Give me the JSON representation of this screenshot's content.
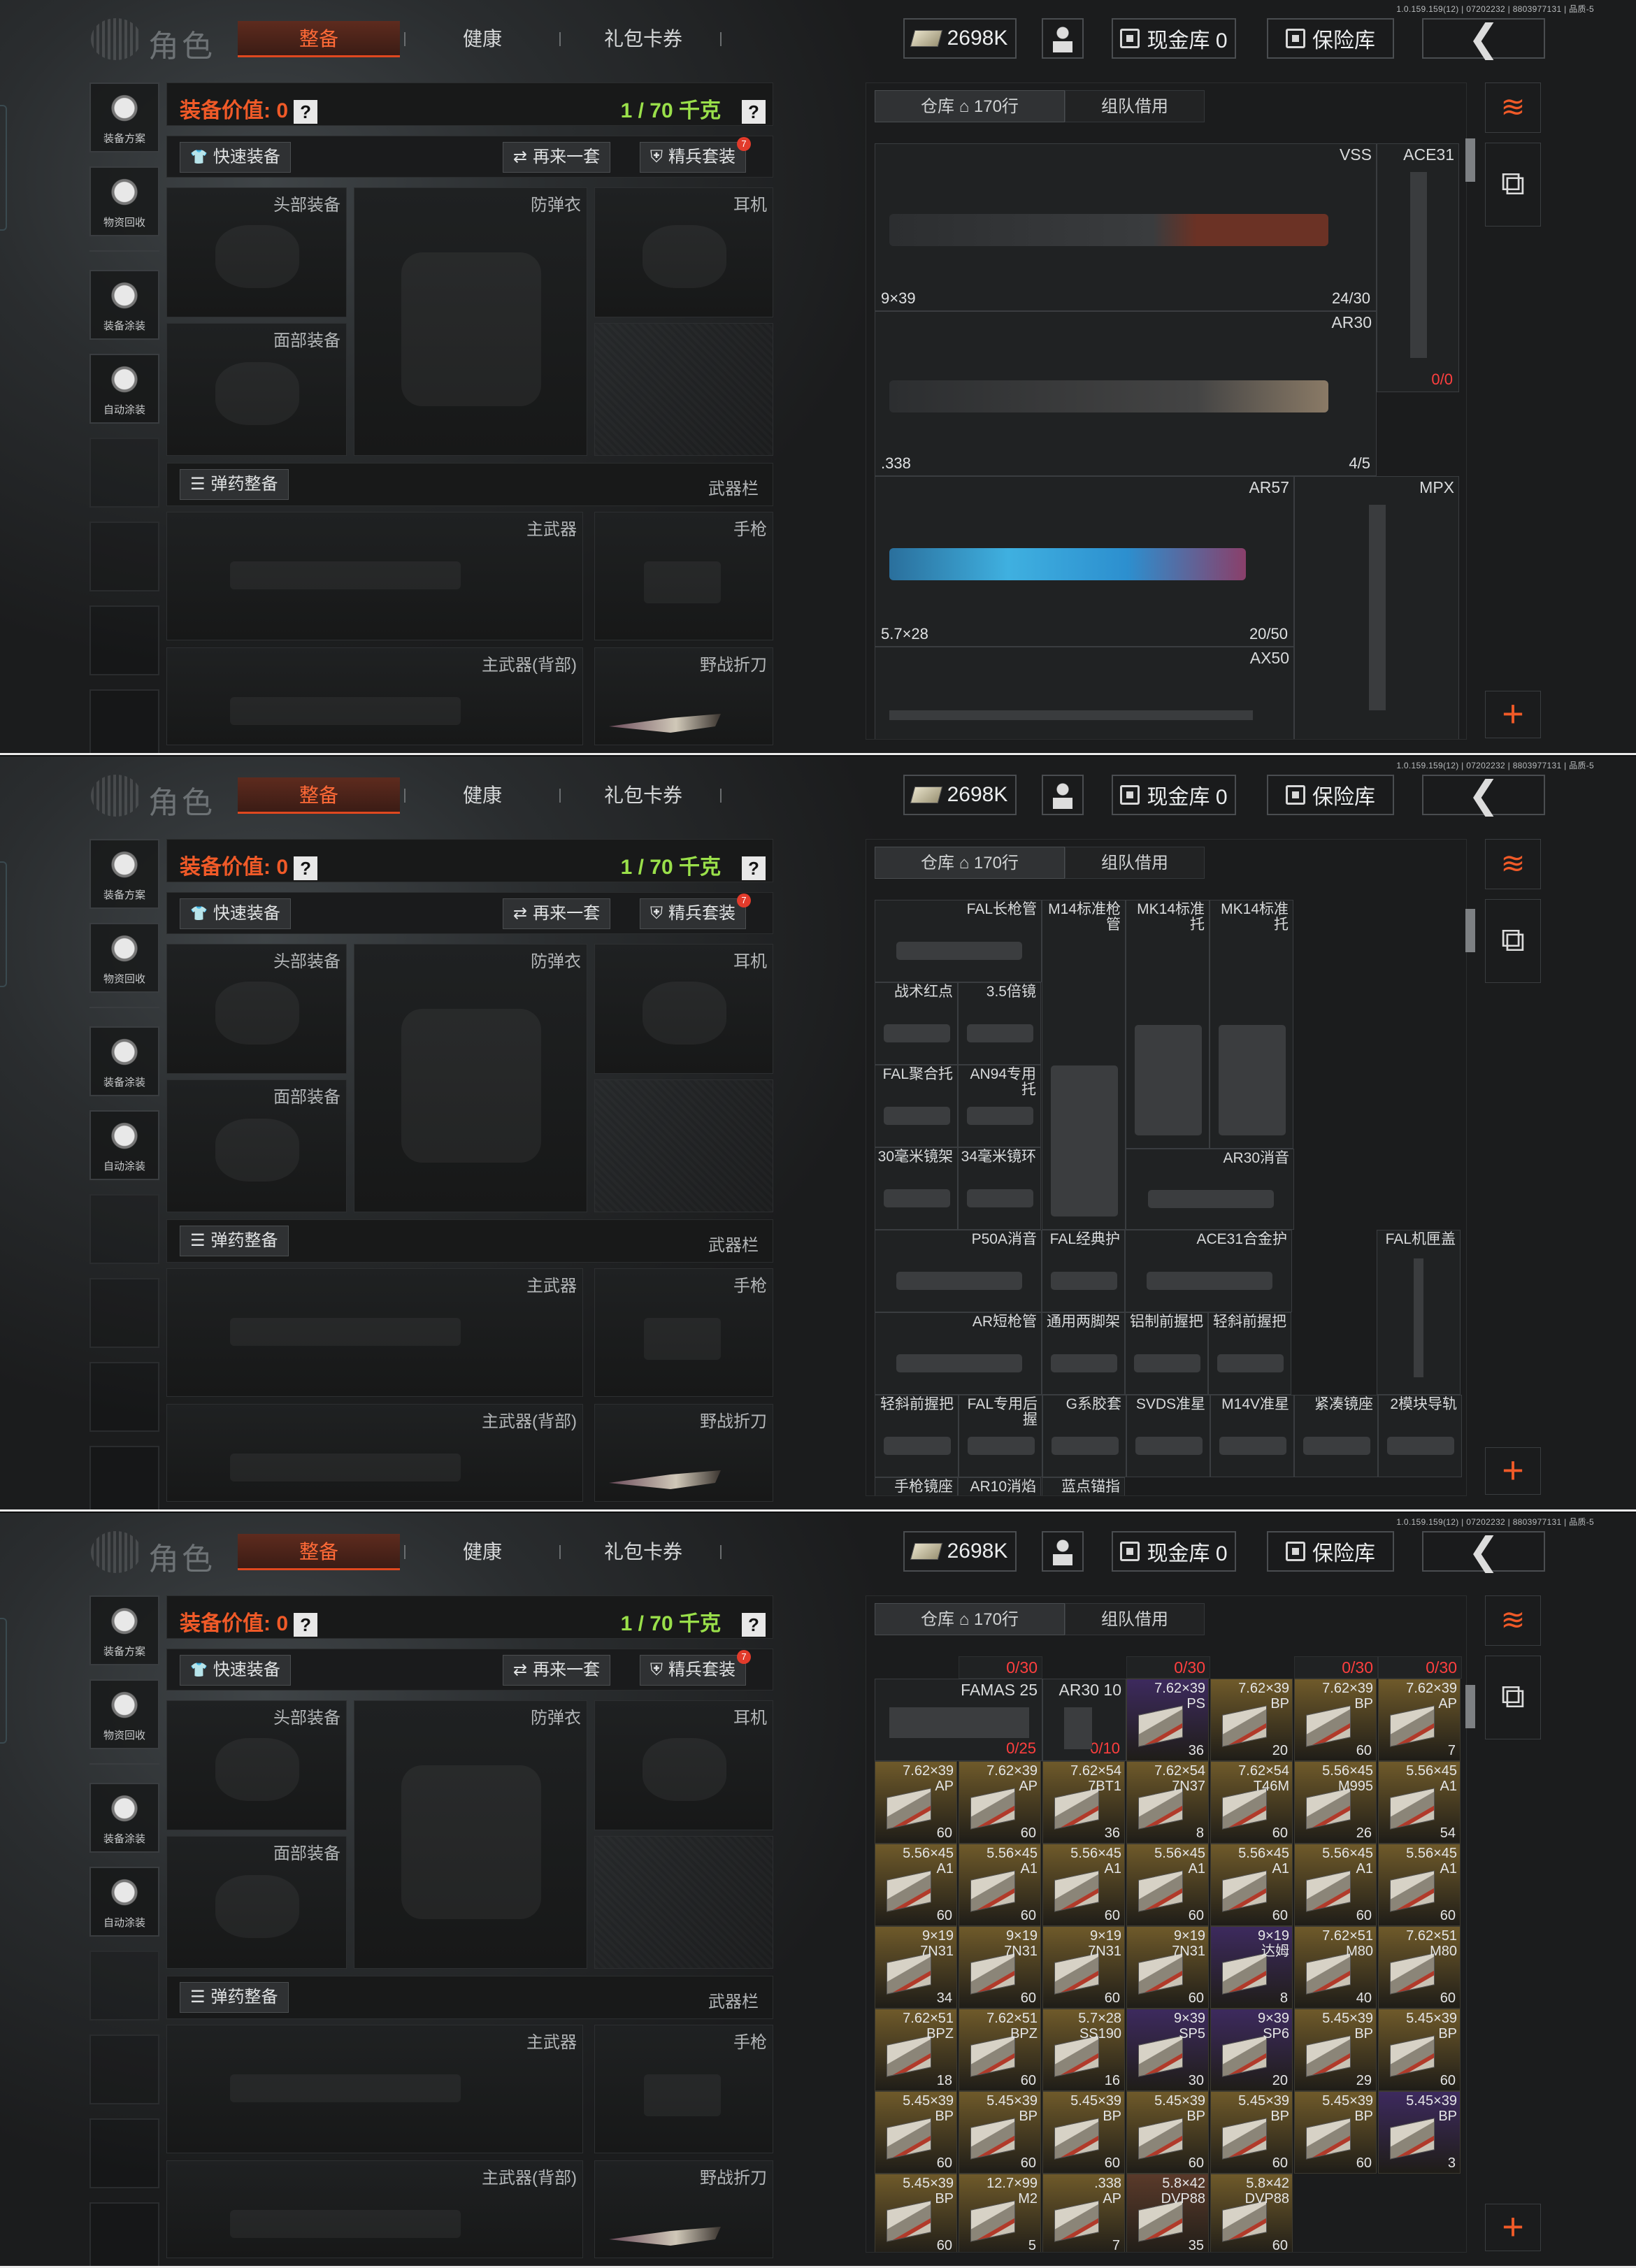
{
  "version": "1.0.159.159(12) | 07202232 | 8803977131 | 品质-5",
  "header": {
    "title": "角色",
    "tabs": [
      "整备",
      "健康",
      "礼包卡券"
    ],
    "cash": "2698K",
    "cash_vault": "现金库 0",
    "safe": "保险库"
  },
  "sidebar": [
    "装备方案",
    "物资回收",
    "装备涂装",
    "自动涂装"
  ],
  "equip": {
    "value_label": "装备价值: 0",
    "weight": "1 / 70 千克",
    "help": "?",
    "quick_equip": "快速装备",
    "again": "再来一套",
    "elite": "精兵套装",
    "elite_badge": "7",
    "slots": {
      "head": "头部装备",
      "armor": "防弹衣",
      "ear": "耳机",
      "face": "面部装备",
      "ammo": "弹药整备",
      "weapons": "武器栏",
      "primary": "主武器",
      "pistol": "手枪",
      "primary_back": "主武器(背部)",
      "knife": "野战折刀"
    }
  },
  "storage": {
    "tab_storage": "仓库",
    "tab_rows": "170行",
    "tab_team": "组队借用"
  },
  "screen1": {
    "items": [
      {
        "name": "VSS",
        "cal": "9×39",
        "count": "24/30"
      },
      {
        "name": "ACE31",
        "count": "0/0"
      },
      {
        "name": "AR30",
        "cal": ".338",
        "count": "4/5"
      },
      {
        "name": "AR57",
        "cal": "5.7×28",
        "count": "20/50"
      },
      {
        "name": "MPX"
      },
      {
        "name": "AX50"
      }
    ]
  },
  "screen2": {
    "items": [
      "FAL长枪管",
      "M14标准枪管",
      "MK14标准托",
      "MK14标准托",
      "战术红点",
      "3.5倍镜",
      "FAL聚合托",
      "AN94专用托",
      "30毫米镜架",
      "34毫米镜环",
      "AR30消音",
      "P50A消音",
      "FAL经典护",
      "ACE31合金护",
      "FAL机匣盖",
      "AR短枪管",
      "通用两脚架",
      "铝制前握把",
      "轻斜前握把",
      "轻斜前握把",
      "FAL专用后握",
      "G系胶套",
      "SVDS准星",
      "M14V准星",
      "紧凑镜座",
      "2模块导轨",
      "手枪镜座",
      "AR10消焰",
      "蓝点锚指"
    ]
  },
  "screen3": {
    "top_counts": [
      "0/30",
      "0/30",
      "0/30",
      "0/30"
    ],
    "mags": [
      {
        "name": "FAMAS 25",
        "count": "0/25"
      },
      {
        "name": "AR30 10",
        "count": "0/10"
      }
    ],
    "ammo": [
      {
        "t1": "7.62×39",
        "t2": "PS",
        "c": "36"
      },
      {
        "t1": "7.62×39",
        "t2": "BP",
        "c": "20"
      },
      {
        "t1": "7.62×39",
        "t2": "BP",
        "c": "60"
      },
      {
        "t1": "7.62×39",
        "t2": "AP",
        "c": "7"
      },
      {
        "t1": "7.62×39",
        "t2": "AP",
        "c": "60"
      },
      {
        "t1": "7.62×39",
        "t2": "AP",
        "c": "60"
      },
      {
        "t1": "7.62×54",
        "t2": "7BT1",
        "c": "36"
      },
      {
        "t1": "7.62×54",
        "t2": "7N37",
        "c": "8"
      },
      {
        "t1": "7.62×54",
        "t2": "T46M",
        "c": "60"
      },
      {
        "t1": "5.56×45",
        "t2": "M995",
        "c": "26"
      },
      {
        "t1": "5.56×45",
        "t2": "A1",
        "c": "54"
      },
      {
        "t1": "5.56×45",
        "t2": "A1",
        "c": "60"
      },
      {
        "t1": "5.56×45",
        "t2": "A1",
        "c": "60"
      },
      {
        "t1": "5.56×45",
        "t2": "A1",
        "c": "60"
      },
      {
        "t1": "5.56×45",
        "t2": "A1",
        "c": "60"
      },
      {
        "t1": "5.56×45",
        "t2": "A1",
        "c": "60"
      },
      {
        "t1": "5.56×45",
        "t2": "A1",
        "c": "60"
      },
      {
        "t1": "5.56×45",
        "t2": "A1",
        "c": "60"
      },
      {
        "t1": "9×19",
        "t2": "7N31",
        "c": "34"
      },
      {
        "t1": "9×19",
        "t2": "7N31",
        "c": "60"
      },
      {
        "t1": "9×19",
        "t2": "7N31",
        "c": "60"
      },
      {
        "t1": "9×19",
        "t2": "7N31",
        "c": "60"
      },
      {
        "t1": "9×19",
        "t2": "达姆",
        "c": "8"
      },
      {
        "t1": "7.62×51",
        "t2": "M80",
        "c": "40"
      },
      {
        "t1": "7.62×51",
        "t2": "M80",
        "c": "60"
      },
      {
        "t1": "7.62×51",
        "t2": "BPZ",
        "c": "18"
      },
      {
        "t1": "7.62×51",
        "t2": "BPZ",
        "c": "60"
      },
      {
        "t1": "5.7×28",
        "t2": "SS190",
        "c": "16"
      },
      {
        "t1": "9×39",
        "t2": "SP5",
        "c": "30"
      },
      {
        "t1": "9×39",
        "t2": "SP6",
        "c": "20"
      },
      {
        "t1": "5.45×39",
        "t2": "BP",
        "c": "29"
      },
      {
        "t1": "5.45×39",
        "t2": "BP",
        "c": "60"
      },
      {
        "t1": "5.45×39",
        "t2": "BP",
        "c": "60"
      },
      {
        "t1": "5.45×39",
        "t2": "BP",
        "c": "60"
      },
      {
        "t1": "5.45×39",
        "t2": "BP",
        "c": "60"
      },
      {
        "t1": "5.45×39",
        "t2": "BP",
        "c": "60"
      },
      {
        "t1": "5.45×39",
        "t2": "BP",
        "c": "60"
      },
      {
        "t1": "5.45×39",
        "t2": "BP",
        "c": "60"
      },
      {
        "t1": "5.45×39",
        "t2": "BP",
        "c": "3"
      },
      {
        "t1": "5.45×39",
        "t2": "BP",
        "c": "60"
      },
      {
        "t1": "12.7×99",
        "t2": "M2",
        "c": "5"
      },
      {
        "t1": ".338",
        "t2": "AP",
        "c": "7"
      },
      {
        "t1": "5.8×42",
        "t2": "DVP88",
        "c": "35"
      },
      {
        "t1": "5.8×42",
        "t2": "DVP88",
        "c": "60"
      }
    ]
  },
  "colors": {
    "accent": "#f05a28",
    "weight": "#9ae04a",
    "ammo_gold": "#6f5a2a",
    "ammo_purple": "#3d2a5e",
    "ammo_brown": "#5a3a2a"
  }
}
